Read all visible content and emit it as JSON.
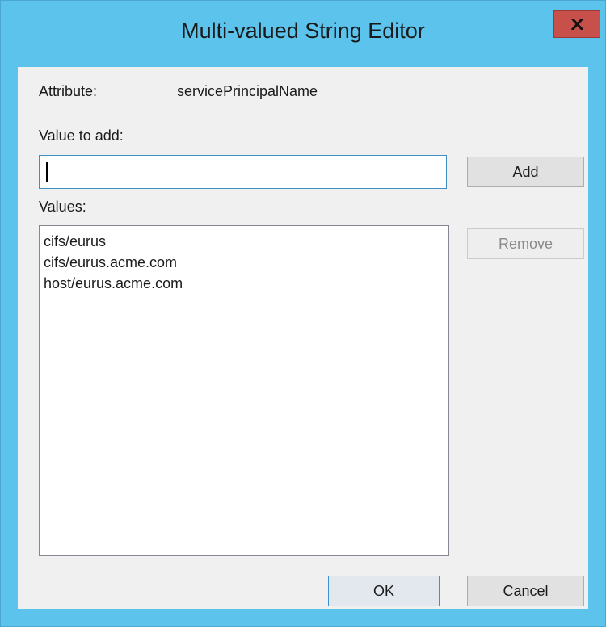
{
  "dialog": {
    "title": "Multi-valued String Editor"
  },
  "attribute": {
    "label": "Attribute:",
    "value": "servicePrincipalName"
  },
  "value_to_add": {
    "label": "Value to add:",
    "value": ""
  },
  "values": {
    "label": "Values:",
    "items": [
      "cifs/eurus",
      "cifs/eurus.acme.com",
      "host/eurus.acme.com"
    ]
  },
  "buttons": {
    "add": "Add",
    "remove": "Remove",
    "ok": "OK",
    "cancel": "Cancel"
  },
  "icons": {
    "close": "close-icon"
  },
  "colors": {
    "title_bar": "#5bc3ec",
    "close_button": "#c7504a",
    "client_background": "#f0f0f0"
  }
}
